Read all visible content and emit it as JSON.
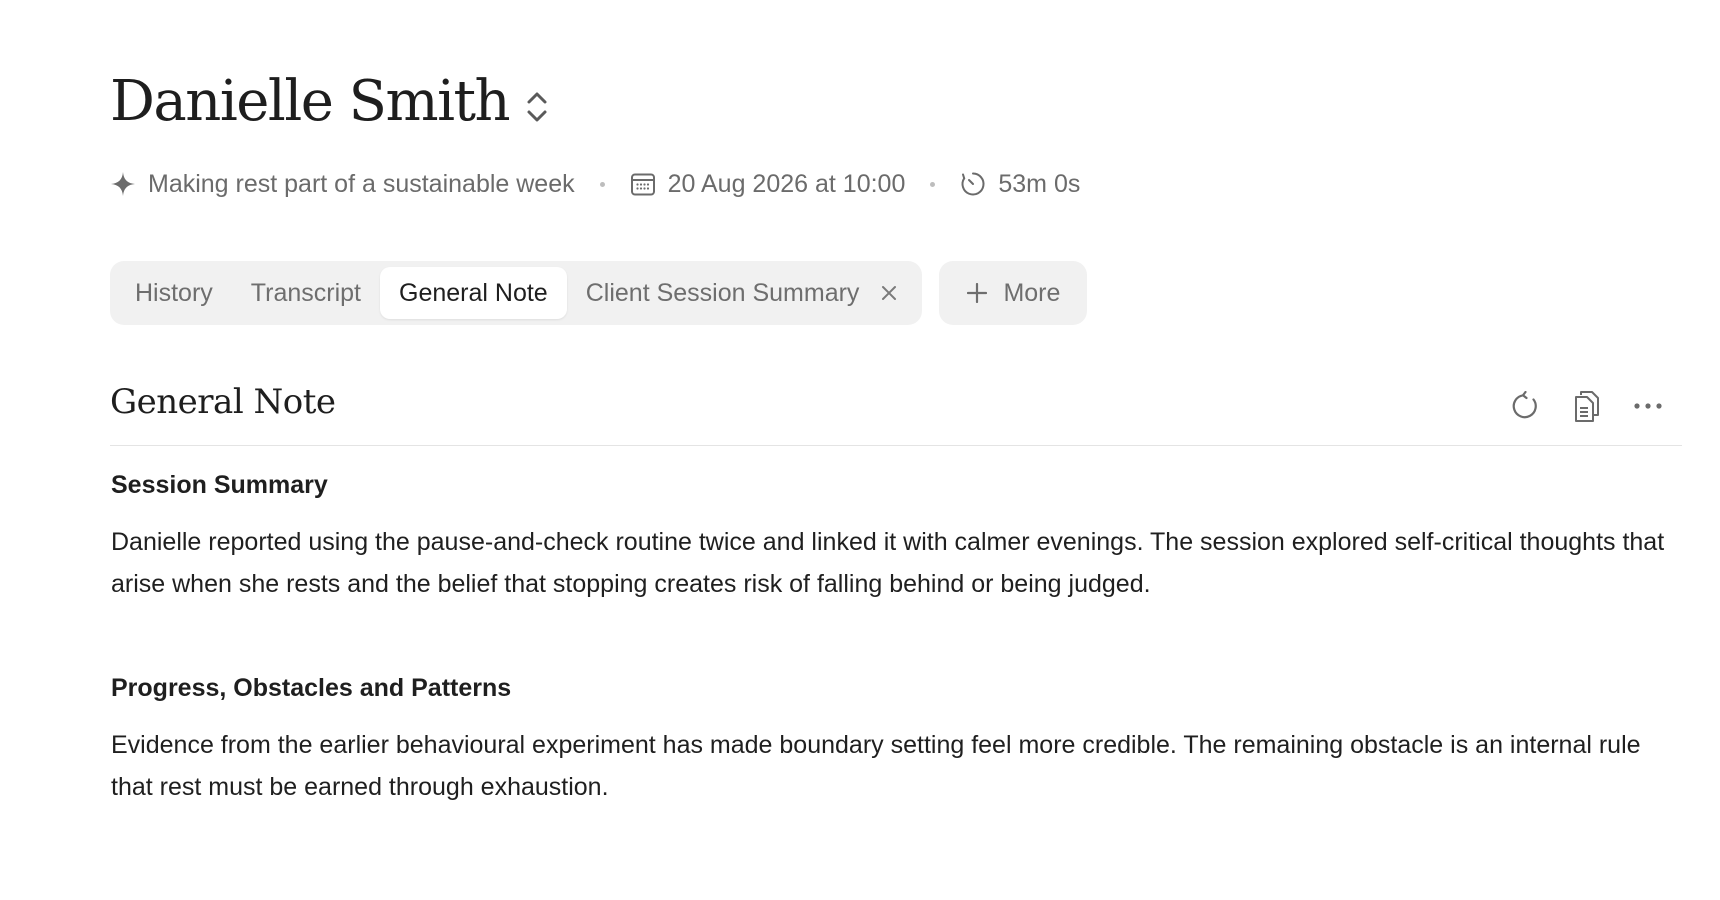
{
  "header": {
    "client_name": "Danielle Smith",
    "switch_icon": "chevron-up-down-icon"
  },
  "meta": {
    "topic_icon": "sparkle-icon",
    "topic": "Making rest part of a sustainable week",
    "date_icon": "calendar-icon",
    "date": "20 Aug 2026 at 10:00",
    "duration_icon": "timer-icon",
    "duration": "53m 0s"
  },
  "tabs": [
    {
      "label": "History",
      "active": false
    },
    {
      "label": "Transcript",
      "active": false
    },
    {
      "label": "General Note",
      "active": true
    },
    {
      "label": "Client Session Summary",
      "active": false,
      "closable": true
    }
  ],
  "more_button": {
    "label": "More",
    "icon": "plus-icon"
  },
  "note": {
    "title": "General Note",
    "actions": [
      "refresh-icon",
      "copy-icon",
      "more-horizontal-icon"
    ],
    "sections": [
      {
        "heading": "Session Summary",
        "text": "Danielle reported using the pause-and-check routine twice and linked it with calmer evenings. The session explored self-critical thoughts that arise when she rests and the belief that stopping creates risk of falling behind or being judged."
      },
      {
        "heading": "Progress, Obstacles and Patterns",
        "text": "Evidence from the earlier behavioural experiment has made boundary setting feel more credible. The remaining obstacle is an internal rule that rest must be earned through exhaustion."
      }
    ]
  },
  "colors": {
    "text_primary": "#1f1f1f",
    "text_secondary": "#6e6e6e",
    "tab_bg": "#f1f1f1",
    "divider": "#e4e4e4"
  }
}
